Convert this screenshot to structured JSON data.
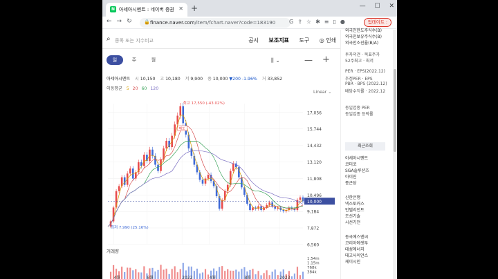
{
  "browser": {
    "tab_title": "아세아시멘트 : 네이버 증권",
    "url_host": "finance.naver.com",
    "url_path": "/item/fchart.naver?code=183190",
    "update_label": "업데이트 :"
  },
  "search": {
    "placeholder": "종목 또는 지수비교"
  },
  "top_tabs": [
    "공시",
    "보조지표",
    "도구",
    "◎ 인쇄"
  ],
  "periods": [
    "일",
    "주",
    "월"
  ],
  "quote": {
    "name": "아세아시멘트",
    "open_label": "시",
    "open": "10,150",
    "high_label": "고",
    "high": "10,180",
    "low_label": "저",
    "low": "9,900",
    "close_label": "종",
    "close": "10,000",
    "change": "▼200",
    "change_pct": "-1.96%",
    "vol_label": "거",
    "volume": "33,852"
  },
  "ma": {
    "label": "이동평균",
    "m5": "5",
    "m20": "20",
    "m60": "60",
    "m120": "120"
  },
  "scale_option": "Linear ⌄",
  "chart_data": {
    "type": "candlestick",
    "y_ticks": [
      "17,056",
      "15,744",
      "14,432",
      "13,120",
      "11,808",
      "10,496",
      "9,184",
      "7,872",
      "6,560"
    ],
    "current_price_tag": "10,000",
    "x_ticks": [
      "4월",
      "8월",
      "2022",
      "4월",
      "8월",
      "2023"
    ],
    "annotations": {
      "high": "최고 17,550 (-43.02%)",
      "low": "최저 7,990 (25.16%)",
      "event": "매도"
    },
    "volume_label": "거래량",
    "volume_ticks": [
      "1.54m",
      "1.15m",
      "768k",
      "384k"
    ],
    "close_path": [
      7990,
      8400,
      9500,
      10800,
      11200,
      11900,
      11300,
      12200,
      12600,
      11800,
      12300,
      13100,
      12800,
      13700,
      13200,
      14100,
      13600,
      12900,
      12400,
      13300,
      14200,
      14800,
      14300,
      15200,
      16100,
      16800,
      17550,
      16200,
      15300,
      14200,
      13600,
      12900,
      12300,
      11700,
      11400,
      11800,
      12100,
      11600,
      11200,
      10400,
      9400,
      10100,
      10800,
      11300,
      12400,
      13000,
      12700,
      11900,
      11100,
      10500,
      9800,
      9300,
      9500,
      9400,
      9600,
      9300,
      9500,
      9700,
      9900,
      9600,
      9400,
      9500,
      9300,
      9200,
      9300,
      9500,
      9400,
      9300,
      10100,
      10300,
      10000
    ]
  },
  "side": {
    "rows_top": [
      "외국인한도주식수(B)",
      "외국인보유주식수(B)",
      "외국인소진율(B/A)"
    ],
    "rows_mid": [
      "투자의견 · 목표주가",
      "52주최고 · 최저"
    ],
    "rows_per": [
      "PER · EPS(2022.12)",
      "추정PER · EPS",
      "PBR · BPS (2022.12)",
      "배당수익률 · 2022.12"
    ],
    "rows_peer": [
      "동일업종 PER",
      "동일업종 등락률"
    ],
    "recent_header": "최근조회",
    "recent": [
      "아세아시멘트",
      "코미코",
      "SGA솔루션즈",
      "아이진",
      "종근당"
    ],
    "more": [
      "신한은행",
      "넥스토커스",
      "인텔리전트",
      "조선기술",
      "시선기전"
    ],
    "more2": [
      "동국에스엔씨",
      "코리아에셋투",
      "대성에너지",
      "태고사이언스",
      "케이시인"
    ]
  }
}
